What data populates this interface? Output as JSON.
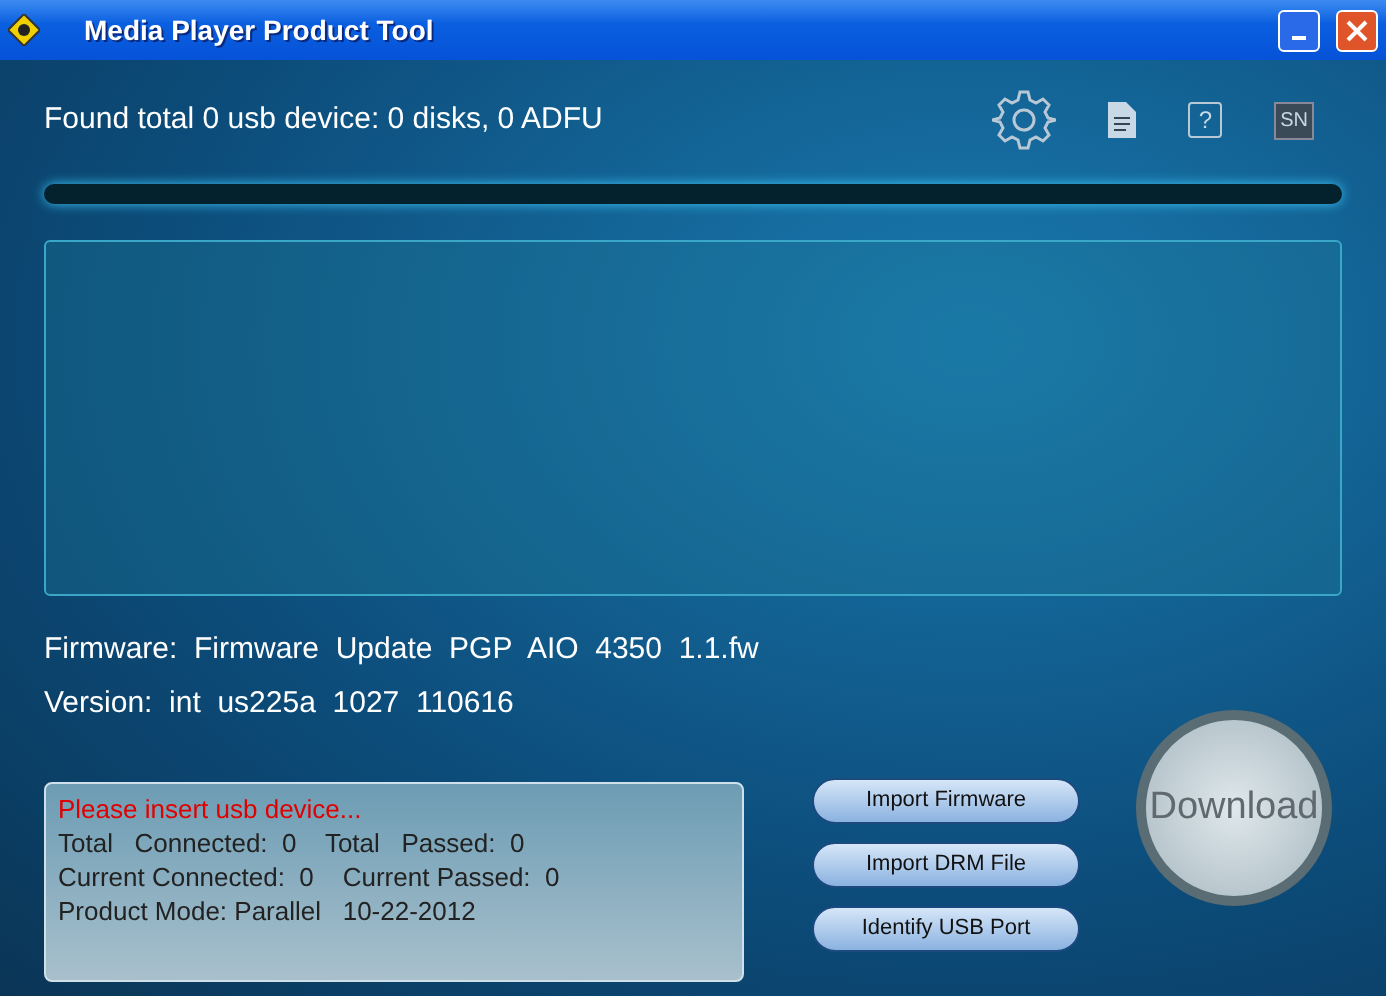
{
  "window": {
    "title": "Media Player Product Tool"
  },
  "status": "Found total 0 usb device: 0 disks, 0 ADFU",
  "toolbar": {
    "help_label": "?",
    "serial_label": "SN"
  },
  "progress": {
    "level": 0
  },
  "firmware": {
    "label": "Firmware:",
    "value": "Firmware  Update  PGP  AIO  4350  1.1.fw"
  },
  "version": {
    "label": "Version:",
    "value": "int  us225a  1027  110616"
  },
  "info_panel": {
    "message": "Please insert usb device...",
    "lines": [
      "Total   Connected:  0    Total   Passed:  0",
      "Current Connected:  0    Current Passed:  0",
      "Product Mode: Parallel   10-22-2012"
    ]
  },
  "buttons": [
    "Import Firmware",
    "Import DRM File",
    "Identify USB Port"
  ],
  "download_button": "Download"
}
